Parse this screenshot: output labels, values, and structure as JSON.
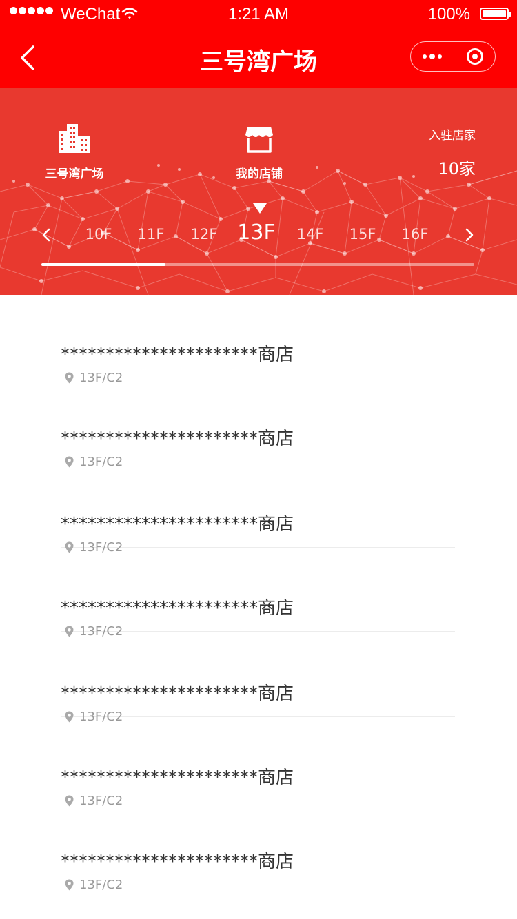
{
  "status_bar": {
    "carrier": "WeChat",
    "time": "1:21 AM",
    "battery": "100%"
  },
  "nav": {
    "title": "三号湾广场"
  },
  "header": {
    "mall_label": "三号湾广场",
    "shop_label": "我的店铺",
    "stores_label": "入驻店家",
    "stores_count": "10家",
    "floors": [
      "10F",
      "11F",
      "12F",
      "13F",
      "14F",
      "15F",
      "16F"
    ],
    "active_floor": "13F"
  },
  "shops": [
    {
      "name": "**********************商店",
      "location": "13F/C2"
    },
    {
      "name": "**********************商店",
      "location": "13F/C2"
    },
    {
      "name": "**********************商店",
      "location": "13F/C2"
    },
    {
      "name": "**********************商店",
      "location": "13F/C2"
    },
    {
      "name": "**********************商店",
      "location": "13F/C2"
    },
    {
      "name": "**********************商店",
      "location": "13F/C2"
    },
    {
      "name": "**********************商店",
      "location": "13F/C2"
    }
  ],
  "colors": {
    "brand_red": "#fe0000",
    "header_red": "#e8392f",
    "text_dark": "#333333",
    "text_muted": "#999999"
  },
  "icons": [
    "back-arrow-icon",
    "more-dots-icon",
    "target-icon",
    "building-icon",
    "shop-icon",
    "chevron-left-icon",
    "chevron-right-icon",
    "location-pin-icon"
  ]
}
